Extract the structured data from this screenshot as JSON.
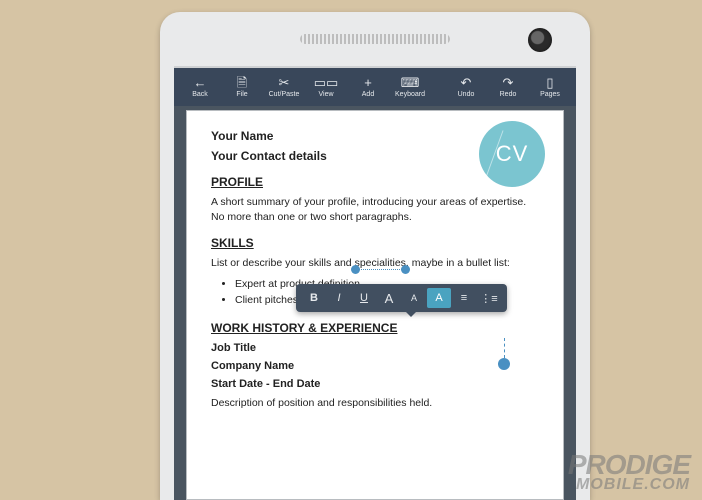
{
  "toolbar": {
    "back": "Back",
    "file": "File",
    "cutpaste": "Cut/Paste",
    "view": "View",
    "add": "Add",
    "keyboard": "Keyboard",
    "undo": "Undo",
    "redo": "Redo",
    "pages": "Pages"
  },
  "doc": {
    "name": "Your Name",
    "contact": "Your Contact details",
    "cv_badge": "CV",
    "profile_heading": "PROFILE",
    "profile_body": "A short summary of your profile, introducing your areas of expertise. No more than one or two short paragraphs.",
    "skills_heading": "SKILLS",
    "skills_body_pre": "List or describe your skills and ",
    "skills_sel": "specialities",
    "skills_body_post": ", maybe in a bullet list:",
    "skills_items": [
      "Expert at product definition",
      "Client pitches and negotiation"
    ],
    "work_heading": "WORK HISTORY & EXPERIENCE",
    "job_title": "Job Title",
    "company": "Company Name",
    "dates": "Start Date - End Date",
    "job_desc": "Description of position and responsibilities held."
  },
  "format_bar": {
    "bold": "B",
    "italic": "I",
    "underline": "U",
    "size_up": "A",
    "size_down": "A",
    "style": "A",
    "align": "≡",
    "list": "⋮≡"
  },
  "watermark": {
    "line1": "PRODIGE",
    "line2": "MOBILE.COM"
  }
}
